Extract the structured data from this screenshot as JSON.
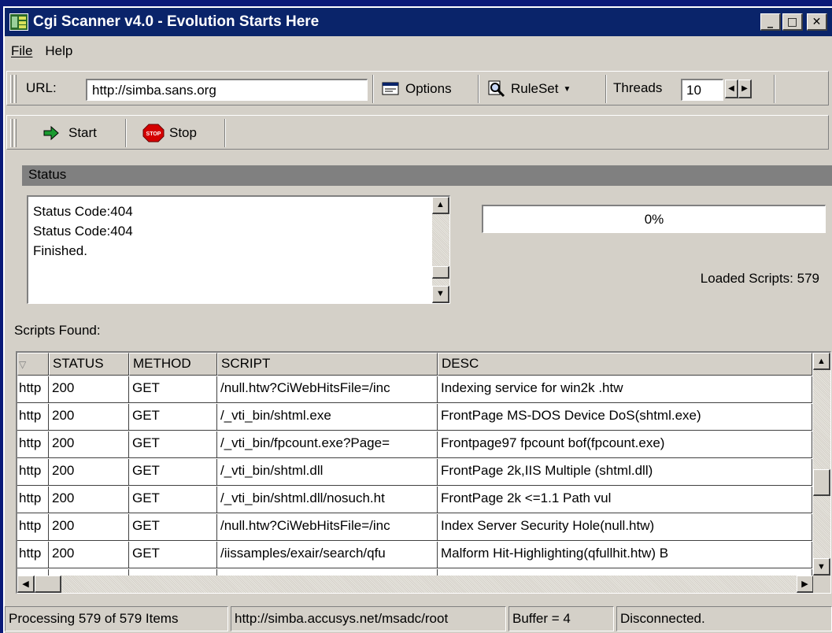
{
  "window": {
    "title": "Cgi Scanner v4.0 - Evolution Starts Here",
    "min_label": "_",
    "max_label": "□",
    "close_label": "✕"
  },
  "menu": [
    {
      "label": "File"
    },
    {
      "label": "Help"
    }
  ],
  "toolbar1": {
    "url_label": "URL:",
    "url_value": "http://simba.sans.org",
    "options_label": "Options",
    "ruleset_label": "RuleSet",
    "threads_label": "Threads",
    "threads_value": "10"
  },
  "toolbar2": {
    "start_label": "Start",
    "stop_label": "Stop",
    "stop_icon_text": "STOP"
  },
  "status": {
    "header": "Status",
    "log": [
      "Status Code:404",
      "Status Code:404",
      "Finished."
    ],
    "progress_text": "0%",
    "progress_value": 0,
    "loaded_scripts": "Loaded Scripts: 579"
  },
  "results": {
    "label": "Scripts Found:",
    "columns": [
      "",
      "STATUS",
      "METHOD",
      "SCRIPT",
      "DESC"
    ],
    "rows": [
      {
        "url": "http",
        "status": "200",
        "method": "GET",
        "script": "/null.htw?CiWebHitsFile=/inc",
        "desc": "Indexing service for win2k .htw"
      },
      {
        "url": "http",
        "status": "200",
        "method": "GET",
        "script": "/_vti_bin/shtml.exe",
        "desc": "FrontPage MS-DOS Device DoS(shtml.exe)"
      },
      {
        "url": "http",
        "status": "200",
        "method": "GET",
        "script": "/_vti_bin/fpcount.exe?Page=",
        "desc": "Frontpage97 fpcount bof(fpcount.exe)"
      },
      {
        "url": "http",
        "status": "200",
        "method": "GET",
        "script": "/_vti_bin/shtml.dll",
        "desc": "FrontPage 2k,IIS Multiple  (shtml.dll)"
      },
      {
        "url": "http",
        "status": "200",
        "method": "GET",
        "script": "/_vti_bin/shtml.dll/nosuch.ht",
        "desc": "FrontPage 2k <=1.1 Path vul"
      },
      {
        "url": "http",
        "status": "200",
        "method": "GET",
        "script": "/null.htw?CiWebHitsFile=/inc",
        "desc": "Index Server Security Hole(null.htw)"
      },
      {
        "url": "http",
        "status": "200",
        "method": "GET",
        "script": "/iissamples/exair/search/qfu",
        "desc": "Malform Hit-Highlighting(qfullhit.htw) B"
      }
    ]
  },
  "statusbar": {
    "processing": "Processing 579 of 579 Items",
    "current_url": "http://simba.accusys.net/msadc/root",
    "buffer": "Buffer =  4",
    "connection": "Disconnected."
  }
}
